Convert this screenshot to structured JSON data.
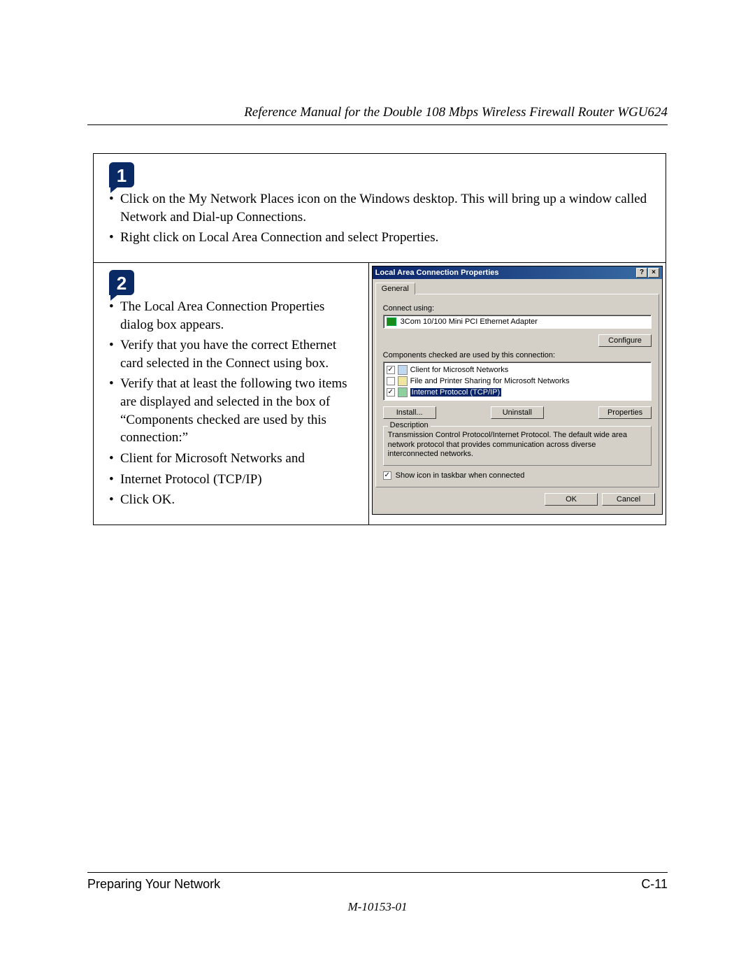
{
  "header": {
    "title": "Reference Manual for the Double 108 Mbps Wireless Firewall Router WGU624"
  },
  "step1": {
    "badge": "1",
    "bullets": [
      "Click on the My Network Places icon on the Windows desktop.  This will bring up a window called Network and Dial-up Connections.",
      "Right click on Local Area Connection and select Properties."
    ]
  },
  "step2": {
    "badge": "2",
    "bullets": [
      "The Local Area Connection Properties dialog box appears.",
      "Verify that you have the correct Ethernet card selected in the Connect using box.",
      "Verify that at least the following two items are displayed and selected in the box of “Components checked are used by this connection:”"
    ],
    "sub_bullets": [
      "Client for Microsoft Networks and",
      "Internet Protocol (TCP/IP)"
    ],
    "final": "Click OK."
  },
  "dialog": {
    "title": "Local Area Connection Properties",
    "help_btn": "?",
    "close_btn": "×",
    "tab": "General",
    "connect_label": "Connect using:",
    "adapter": "3Com 10/100 Mini PCI Ethernet Adapter",
    "configure_btn": "Configure",
    "components_label": "Components checked are used by this connection:",
    "components": [
      {
        "checked": "✓",
        "icon": "client",
        "name": "Client for Microsoft Networks",
        "selected": false
      },
      {
        "checked": "",
        "icon": "share",
        "name": "File and Printer Sharing for Microsoft Networks",
        "selected": false
      },
      {
        "checked": "✓",
        "icon": "proto",
        "name": "Internet Protocol (TCP/IP)",
        "selected": true
      }
    ],
    "install_btn": "Install...",
    "uninstall_btn": "Uninstall",
    "properties_btn": "Properties",
    "desc_legend": "Description",
    "desc_text": "Transmission Control Protocol/Internet Protocol. The default wide area network protocol that provides communication across diverse interconnected networks.",
    "taskbar_chk": "✓",
    "taskbar_label": "Show icon in taskbar when connected",
    "ok_btn": "OK",
    "cancel_btn": "Cancel"
  },
  "footer": {
    "section": "Preparing Your Network",
    "page": "C-11",
    "docnum": "M-10153-01"
  }
}
